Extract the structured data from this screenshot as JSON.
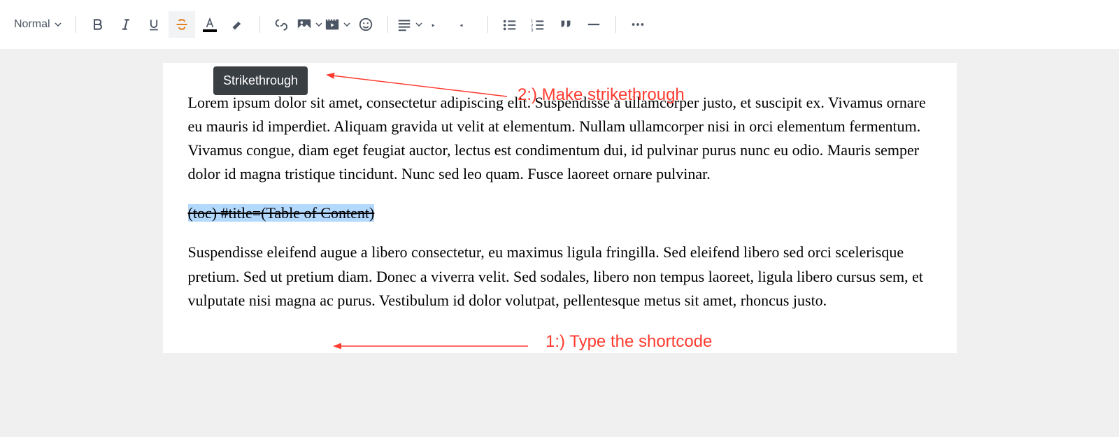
{
  "toolbar": {
    "paragraph_style": "Normal",
    "tooltip_text": "Strikethrough"
  },
  "annotations": {
    "step1": "1:) Type the shortcode",
    "step2": "2:) Make strikethrough"
  },
  "content": {
    "paragraph1": "Lorem ipsum dolor sit amet, consectetur adipiscing elit. Suspendisse a ullamcorper justo, et suscipit ex. Vivamus ornare eu mauris id imperdiet. Aliquam gravida ut velit at elementum. Nullam ullamcorper nisi in orci elementum fermentum. Vivamus congue, diam eget feugiat auctor, lectus est condimentum dui, id pulvinar purus nunc eu odio. Mauris semper dolor id magna tristique tincidunt. Nunc sed leo quam. Fusce laoreet ornare pulvinar.",
    "shortcode": "(toc) #title=(Table of Content)",
    "paragraph2": "Suspendisse eleifend augue a libero consectetur, eu maximus ligula fringilla. Sed eleifend libero sed orci scelerisque pretium. Sed ut pretium diam. Donec a viverra velit. Sed sodales, libero non tempus laoreet, ligula libero cursus sem, et vulputate nisi magna ac purus. Vestibulum id dolor volutpat, pellentesque metus sit amet, rhoncus justo."
  }
}
